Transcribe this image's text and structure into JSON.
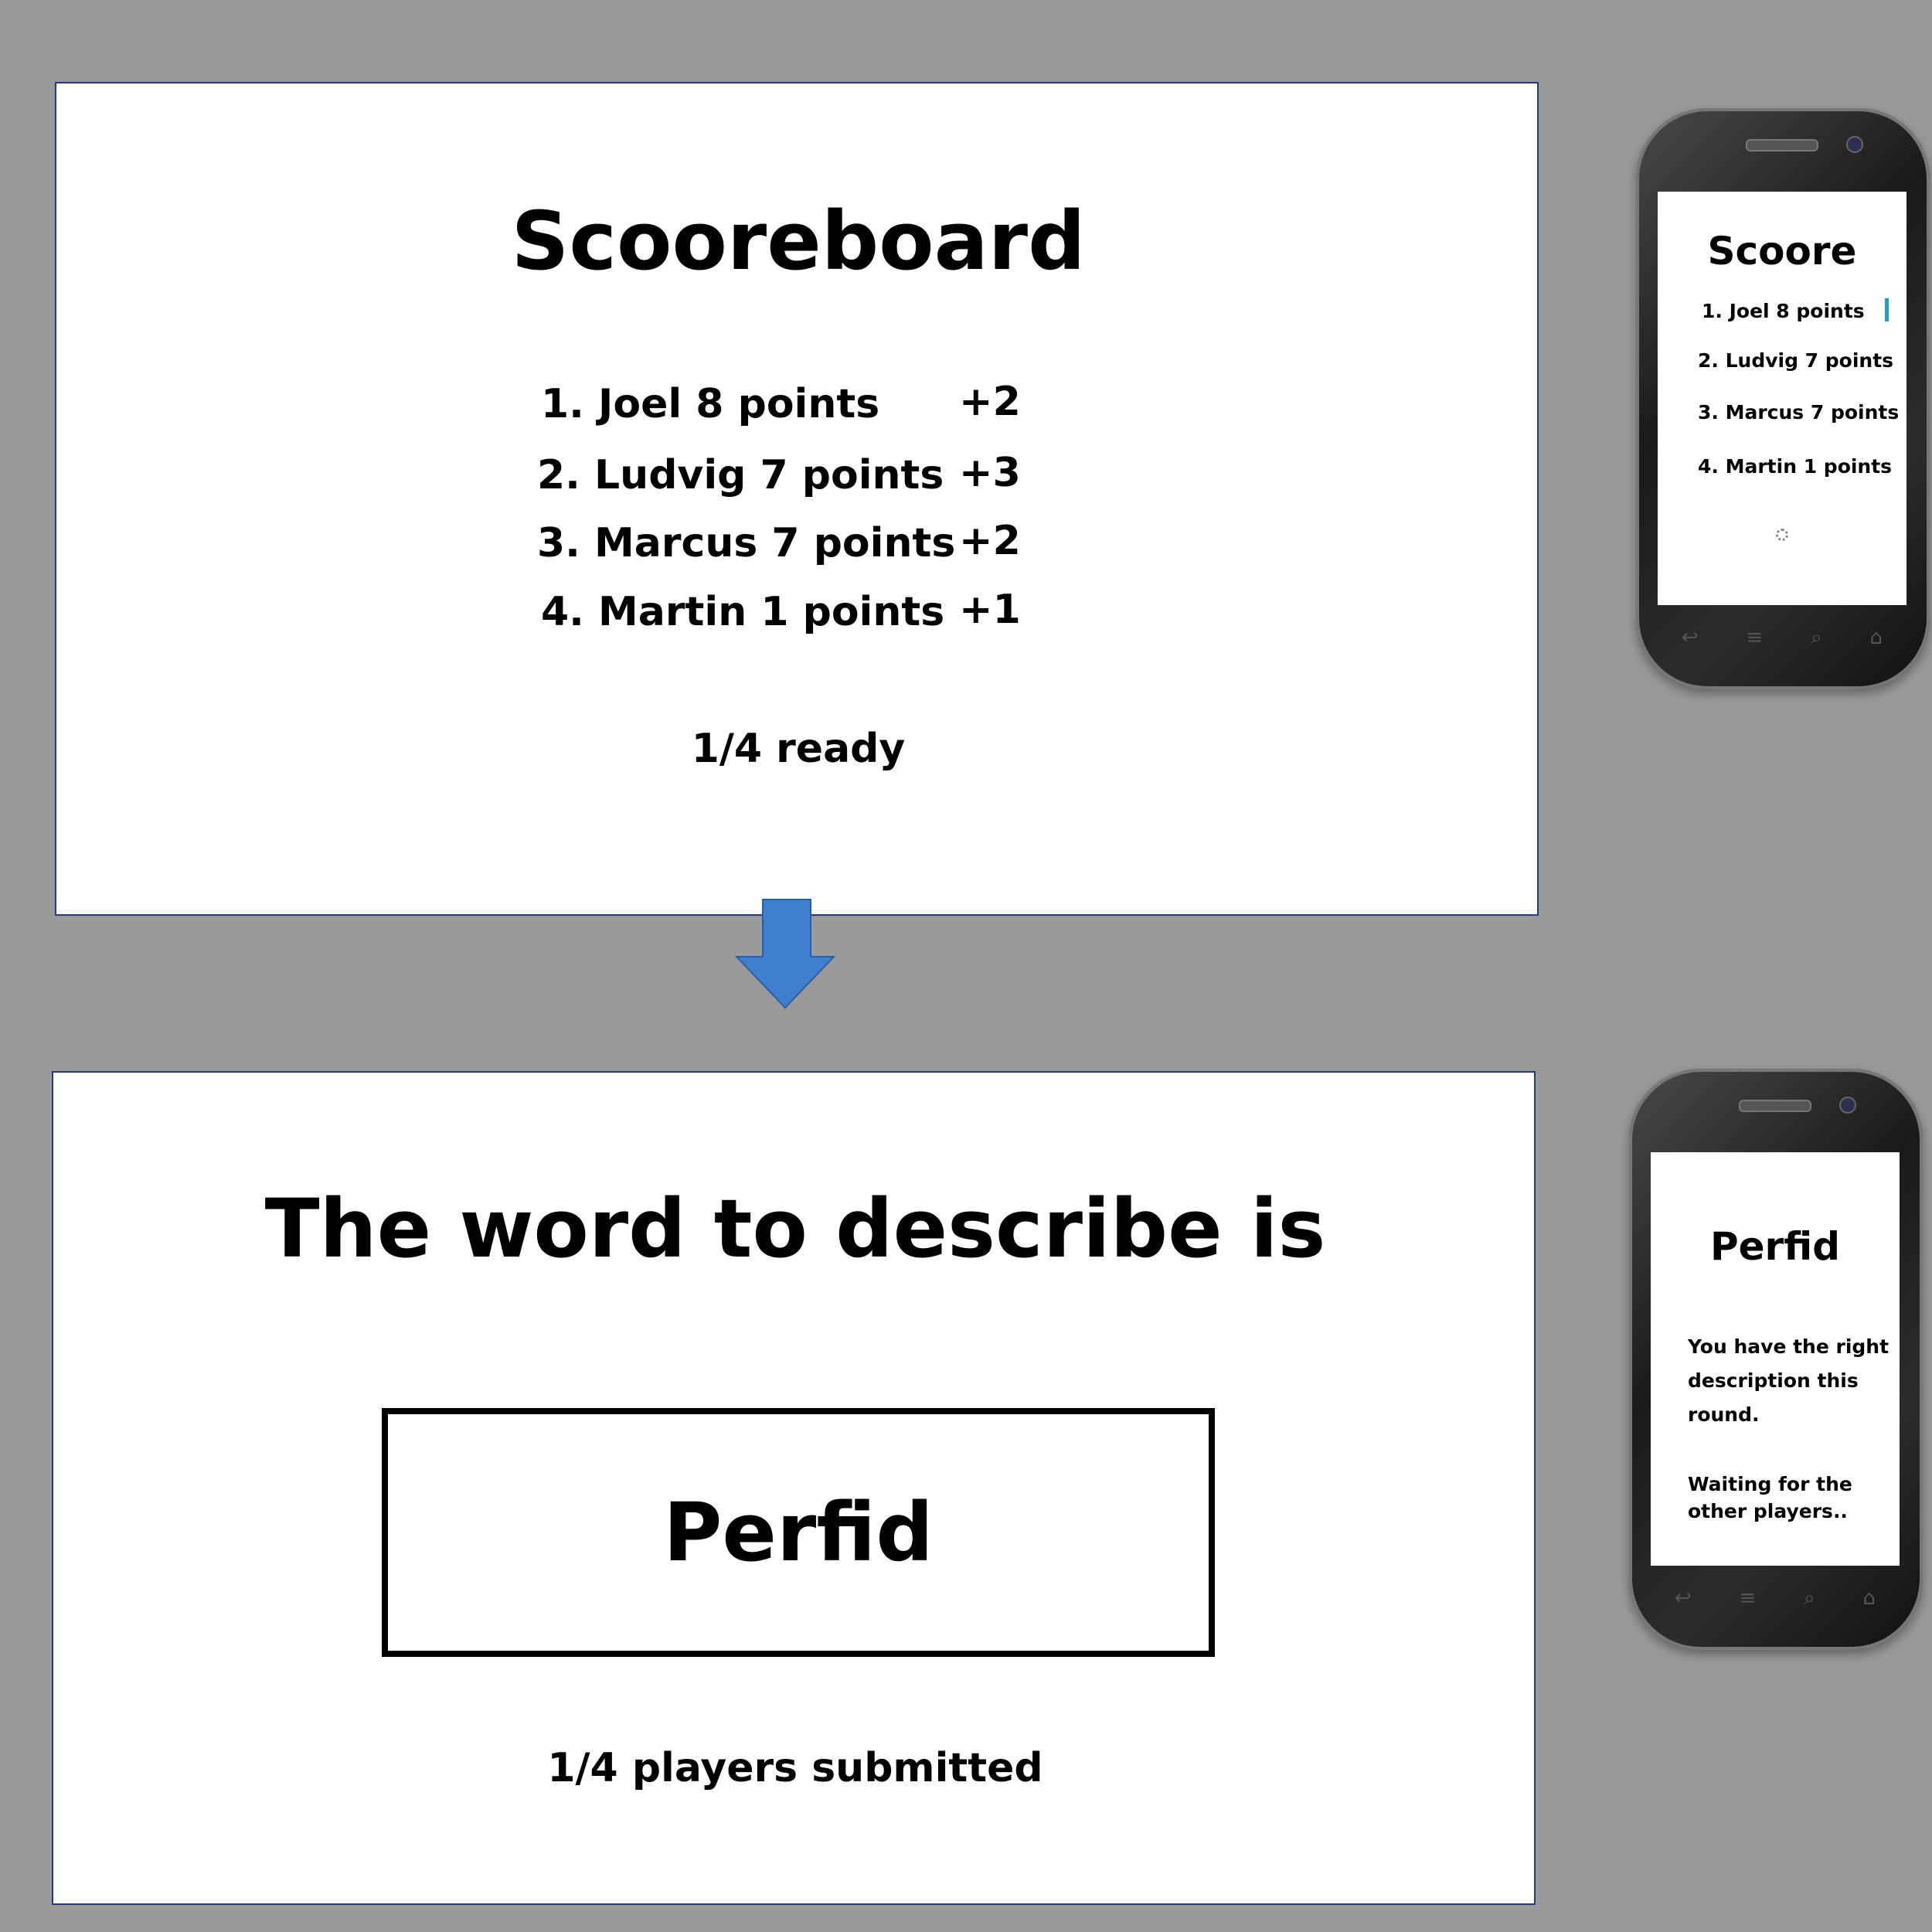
{
  "scoreboard": {
    "title": "Scooreboard",
    "entries": [
      {
        "text": "1. Joel 8 points",
        "delta": "+2"
      },
      {
        "text": "2. Ludvig 7 points",
        "delta": "+3"
      },
      {
        "text": "3. Marcus 7 points",
        "delta": "+2"
      },
      {
        "text": "4. Martin 1 points",
        "delta": "+1"
      }
    ],
    "ready": "1/4 ready"
  },
  "word_screen": {
    "heading": "The word to describe is",
    "word": "Perfid",
    "submitted": "1/4 players submitted"
  },
  "phone_score": {
    "title": "Scoore",
    "entries": [
      "1. Joel 8 points",
      "2. Ludvig 7 points",
      "3. Marcus 7 points",
      "4. Martin 1 points"
    ]
  },
  "phone_word": {
    "title": "Perfid",
    "message": "You have the right description this round.",
    "waiting": "Waiting for the other players.."
  },
  "colors": {
    "background": "#9a9a9a",
    "slide_border": "#27378a",
    "arrow": "#3f7fd0",
    "scrollbar": "#1ba1c7"
  },
  "icons": {
    "arrow": "down-arrow-icon",
    "spinner": "loading-spinner-icon",
    "back": "back-icon",
    "menu": "menu-icon",
    "search": "search-icon",
    "home": "home-icon"
  }
}
